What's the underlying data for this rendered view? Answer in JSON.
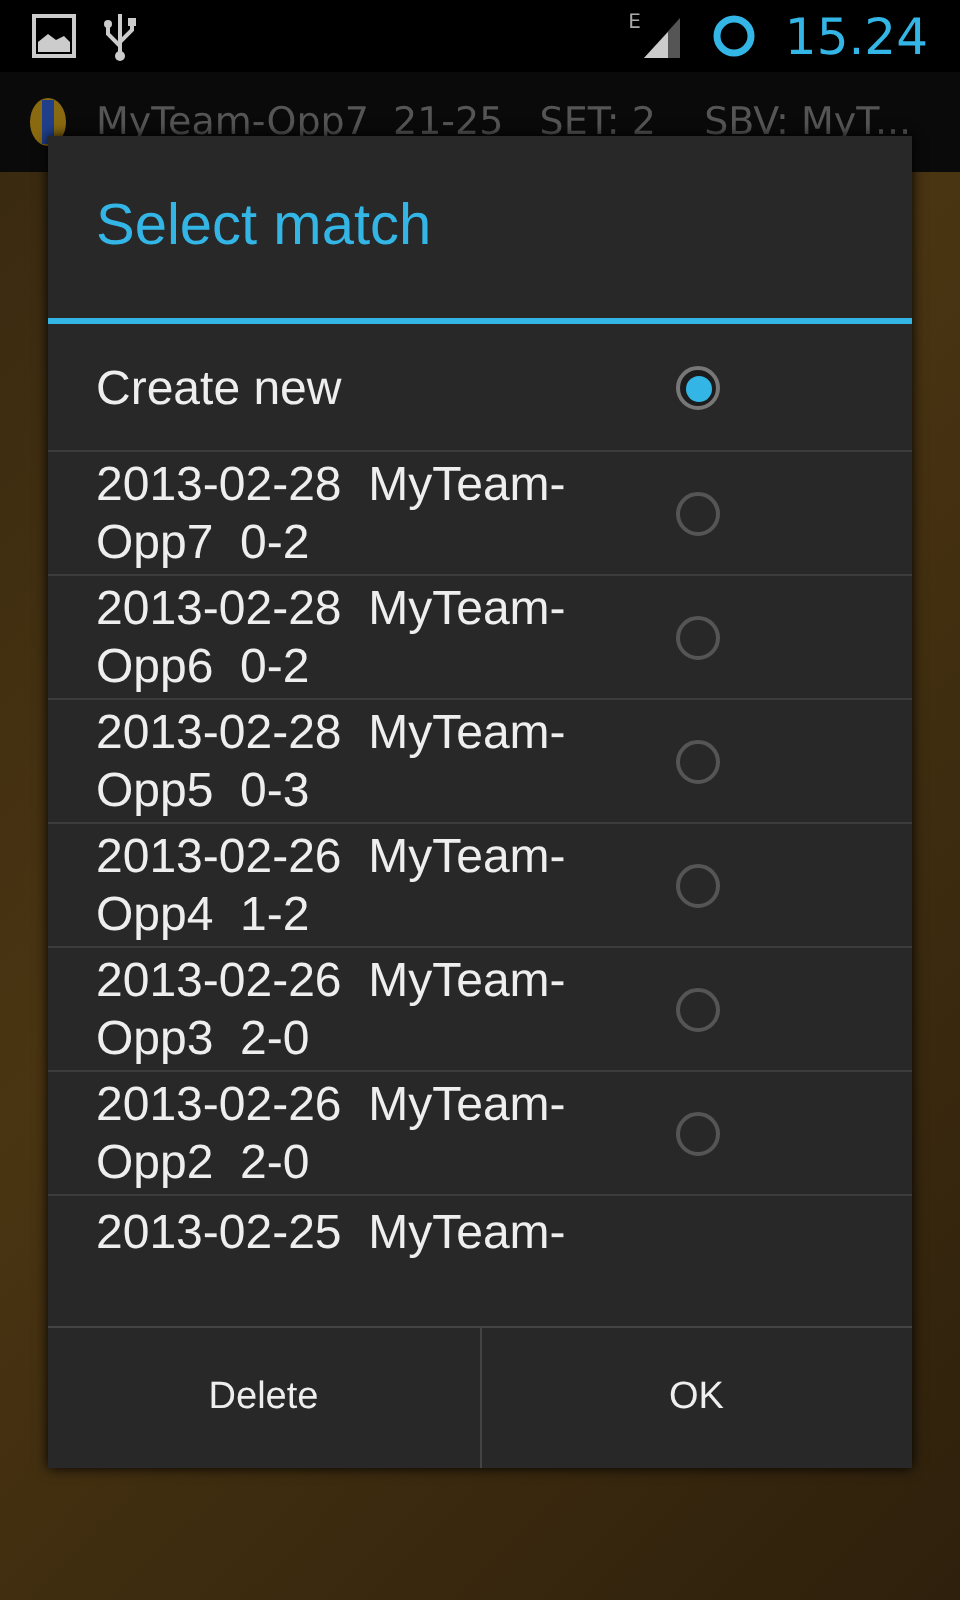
{
  "status_bar": {
    "network": "E",
    "time": "15.24"
  },
  "notification": {
    "text": "MyTeam-Opp7  21-25   SET: 2    SBV: MyT..."
  },
  "dialog": {
    "title": "Select match",
    "items": [
      {
        "label": "Create new",
        "selected": true
      },
      {
        "label": "2013-02-28  MyTeam-Opp7  0-2",
        "selected": false
      },
      {
        "label": "2013-02-28  MyTeam-Opp6  0-2",
        "selected": false
      },
      {
        "label": "2013-02-28  MyTeam-Opp5  0-3",
        "selected": false
      },
      {
        "label": "2013-02-26  MyTeam-Opp4  1-2",
        "selected": false
      },
      {
        "label": "2013-02-26  MyTeam-Opp3  2-0",
        "selected": false
      },
      {
        "label": "2013-02-26  MyTeam-Opp2  2-0",
        "selected": false
      },
      {
        "label": "2013-02-25  MyTeam-"
      }
    ],
    "buttons": [
      "Delete",
      "OK"
    ]
  }
}
